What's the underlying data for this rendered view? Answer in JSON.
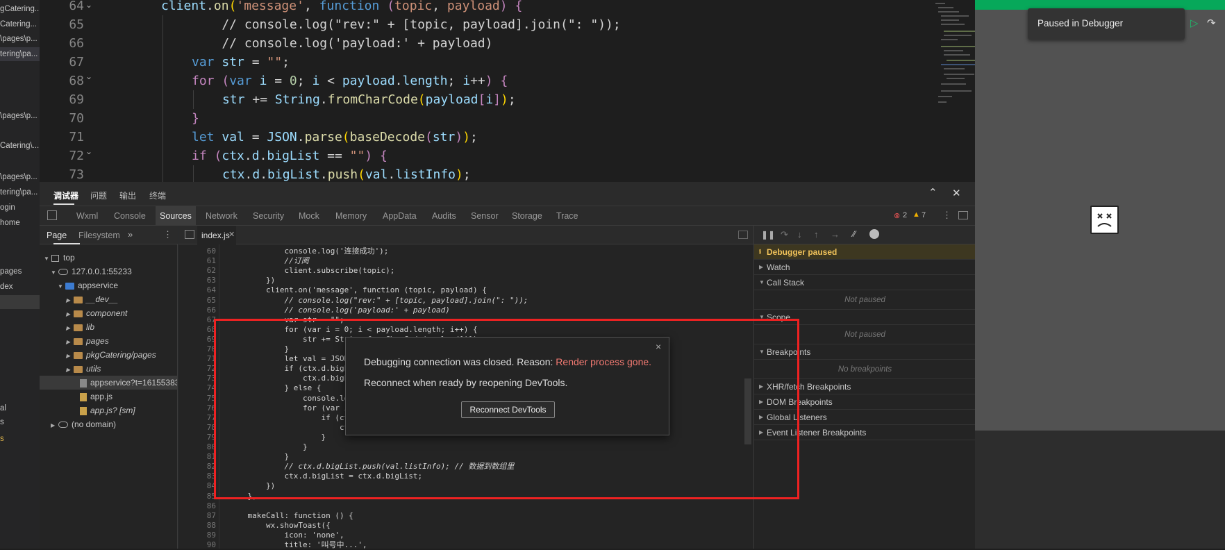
{
  "left_strip": {
    "items": [
      "gCatering...",
      "Catering...",
      "\\pages\\p...",
      "tering\\pa...",
      "\\pages\\p...",
      "Catering\\...",
      "\\pages\\p...",
      "tering\\pa...",
      "ogin",
      "home",
      "pages",
      "dex",
      "al",
      "s",
      "s"
    ]
  },
  "editor": {
    "line_numbers": [
      "64",
      "65",
      "66",
      "67",
      "68",
      "69",
      "70",
      "71",
      "72",
      "73"
    ],
    "lines": [
      "client.on('message', function (topic, payload) {",
      "    // console.log(\"rev:\" + [topic, payload].join(\": \"));",
      "    // console.log('payload:' + payload)",
      "    var str = \"\";",
      "    for (var i = 0; i < payload.length; i++) {",
      "        str += String.fromCharCode(payload[i]);",
      "    }",
      "    let val = JSON.parse(baseDecode(str));",
      "    if (ctx.d.bigList == \"\") {",
      "        ctx.d.bigList.push(val.listInfo);"
    ]
  },
  "devtools": {
    "title_tabs": [
      "调试器",
      "问题",
      "输出",
      "终端"
    ],
    "tabs": [
      "Wxml",
      "Console",
      "Sources",
      "Network",
      "Security",
      "Mock",
      "Memory",
      "AppData",
      "Audits",
      "Sensor",
      "Storage",
      "Trace"
    ],
    "active_tab": "Sources",
    "error_count": "2",
    "warning_count": "7",
    "nav_tabs": [
      "Page",
      "Filesystem"
    ],
    "tree": {
      "top": "top",
      "host": "127.0.0.1:55233",
      "appservice": "appservice",
      "folders": [
        "__dev__",
        "component",
        "lib",
        "pages",
        "pkgCatering/pages",
        "utils"
      ],
      "files": [
        "appservice?t=16155383",
        "app.js",
        "app.js? [sm]"
      ],
      "no_domain": "(no domain)"
    },
    "source_tab": "index.js",
    "source_line_numbers": [
      "60",
      "61",
      "62",
      "63",
      "64",
      "65",
      "66",
      "67",
      "68",
      "69",
      "70",
      "71",
      "72",
      "73",
      "74",
      "75",
      "76",
      "77",
      "78",
      "79",
      "80",
      "81",
      "82",
      "83",
      "84",
      "85",
      "86",
      "87",
      "88",
      "89",
      "90"
    ],
    "source_lines": [
      "            console.log('连接成功');",
      "            //订阅",
      "            client.subscribe(topic);",
      "        })",
      "        client.on('message', function (topic, payload) {",
      "            // console.log(\"rev:\" + [topic, payload].join(\": \"));",
      "            // console.log('payload:' + payload)",
      "            var str = \"\";",
      "            for (var i = 0; i < payload.length; i++) {",
      "                str += String.fromCharCode(payload[i]);",
      "            }",
      "            let val = JSON.parse",
      "            if (ctx.d.bigList =",
      "                ctx.d.bigList.pu",
      "            } else {",
      "                console.log('ct",
      "                for (var i = 0;",
      "                    if (ctx.d.b",
      "                        ctx.d.b",
      "                    }",
      "                }",
      "            }",
      "            // ctx.d.bigList.push(val.listInfo); // 数据到数组里",
      "            ctx.d.bigList = ctx.d.bigList;",
      "        })",
      "    },",
      "",
      "    makeCall: function () {",
      "        wx.showToast({",
      "            icon: 'none',",
      "            title: '叫号中...',"
    ]
  },
  "debugger": {
    "paused": "Debugger paused",
    "watch": "Watch",
    "call_stack": "Call Stack",
    "not_paused": "Not paused",
    "scope": "Scope",
    "scope_not_paused": "Not paused",
    "breakpoints": "Breakpoints",
    "no_breakpoints": "No breakpoints",
    "xhr": "XHR/fetch Breakpoints",
    "dom": "DOM Breakpoints",
    "global": "Global Listeners",
    "event": "Event Listener Breakpoints"
  },
  "simulator": {
    "paused_label": "Paused in Debugger"
  },
  "dialog": {
    "line1": "Debugging connection was closed. Reason: ",
    "reason": "Render process gone.",
    "line2": "Reconnect when ready by reopening DevTools.",
    "button": "Reconnect DevTools"
  },
  "colors": {
    "accent_red": "#ee2222",
    "sim_green": "#07a85a",
    "reason_red": "#f37a72"
  }
}
